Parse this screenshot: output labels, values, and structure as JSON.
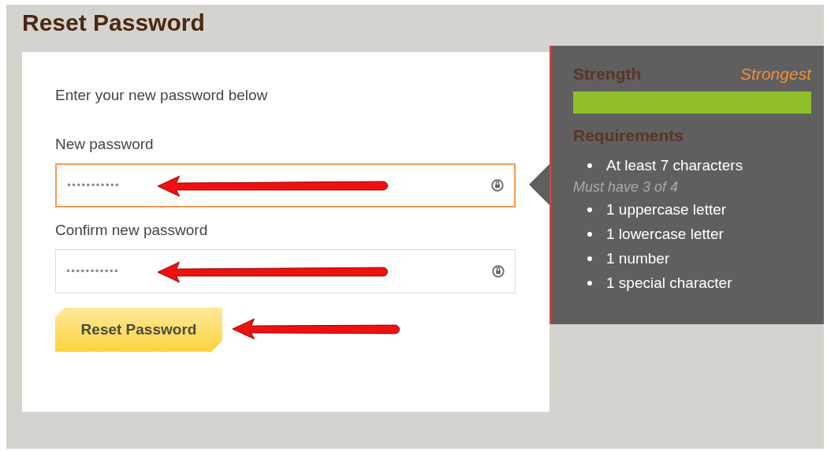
{
  "page": {
    "title": "Reset Password"
  },
  "form": {
    "intro": "Enter your new password below",
    "fields": [
      {
        "label": "New password",
        "value": "•••••••••••",
        "focused": true
      },
      {
        "label": "Confirm new password",
        "value": "•••••••••••",
        "focused": false
      }
    ],
    "button": "Reset Password"
  },
  "strength_panel": {
    "label": "Strength",
    "rating": "Strongest",
    "level": 1,
    "requirements_heading": "Requirements",
    "required": [
      "At least 7 characters"
    ],
    "choice_note": "Must have 3 of 4",
    "choices": [
      "1 uppercase letter",
      "1 lowercase letter",
      "1 number",
      "1 special character"
    ]
  }
}
